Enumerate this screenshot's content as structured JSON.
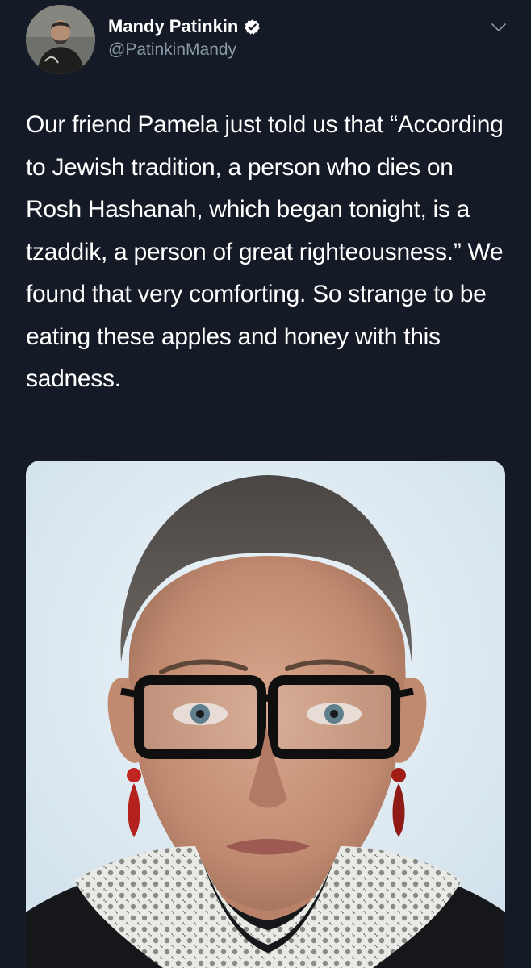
{
  "colors": {
    "background": "#151b26",
    "text_primary": "#ffffff",
    "text_secondary": "#8899a6",
    "verified_badge": "#ffffff"
  },
  "tweet": {
    "author": {
      "name": "Mandy Patinkin",
      "handle": "@PatinkinMandy",
      "verified": true,
      "avatar_icon": "user-avatar-photo"
    },
    "menu_icon": "chevron-down-icon",
    "text": "Our friend Pamela just told us that “According to Jewish tradition, a person who dies on Rosh Hashanah, which began tonight, is a tzaddik, a person of great righteousness.” We found that very comforting. So strange to be eating these apples and honey with this sadness.",
    "media": {
      "type": "photo",
      "icon": "portrait-photo"
    }
  }
}
